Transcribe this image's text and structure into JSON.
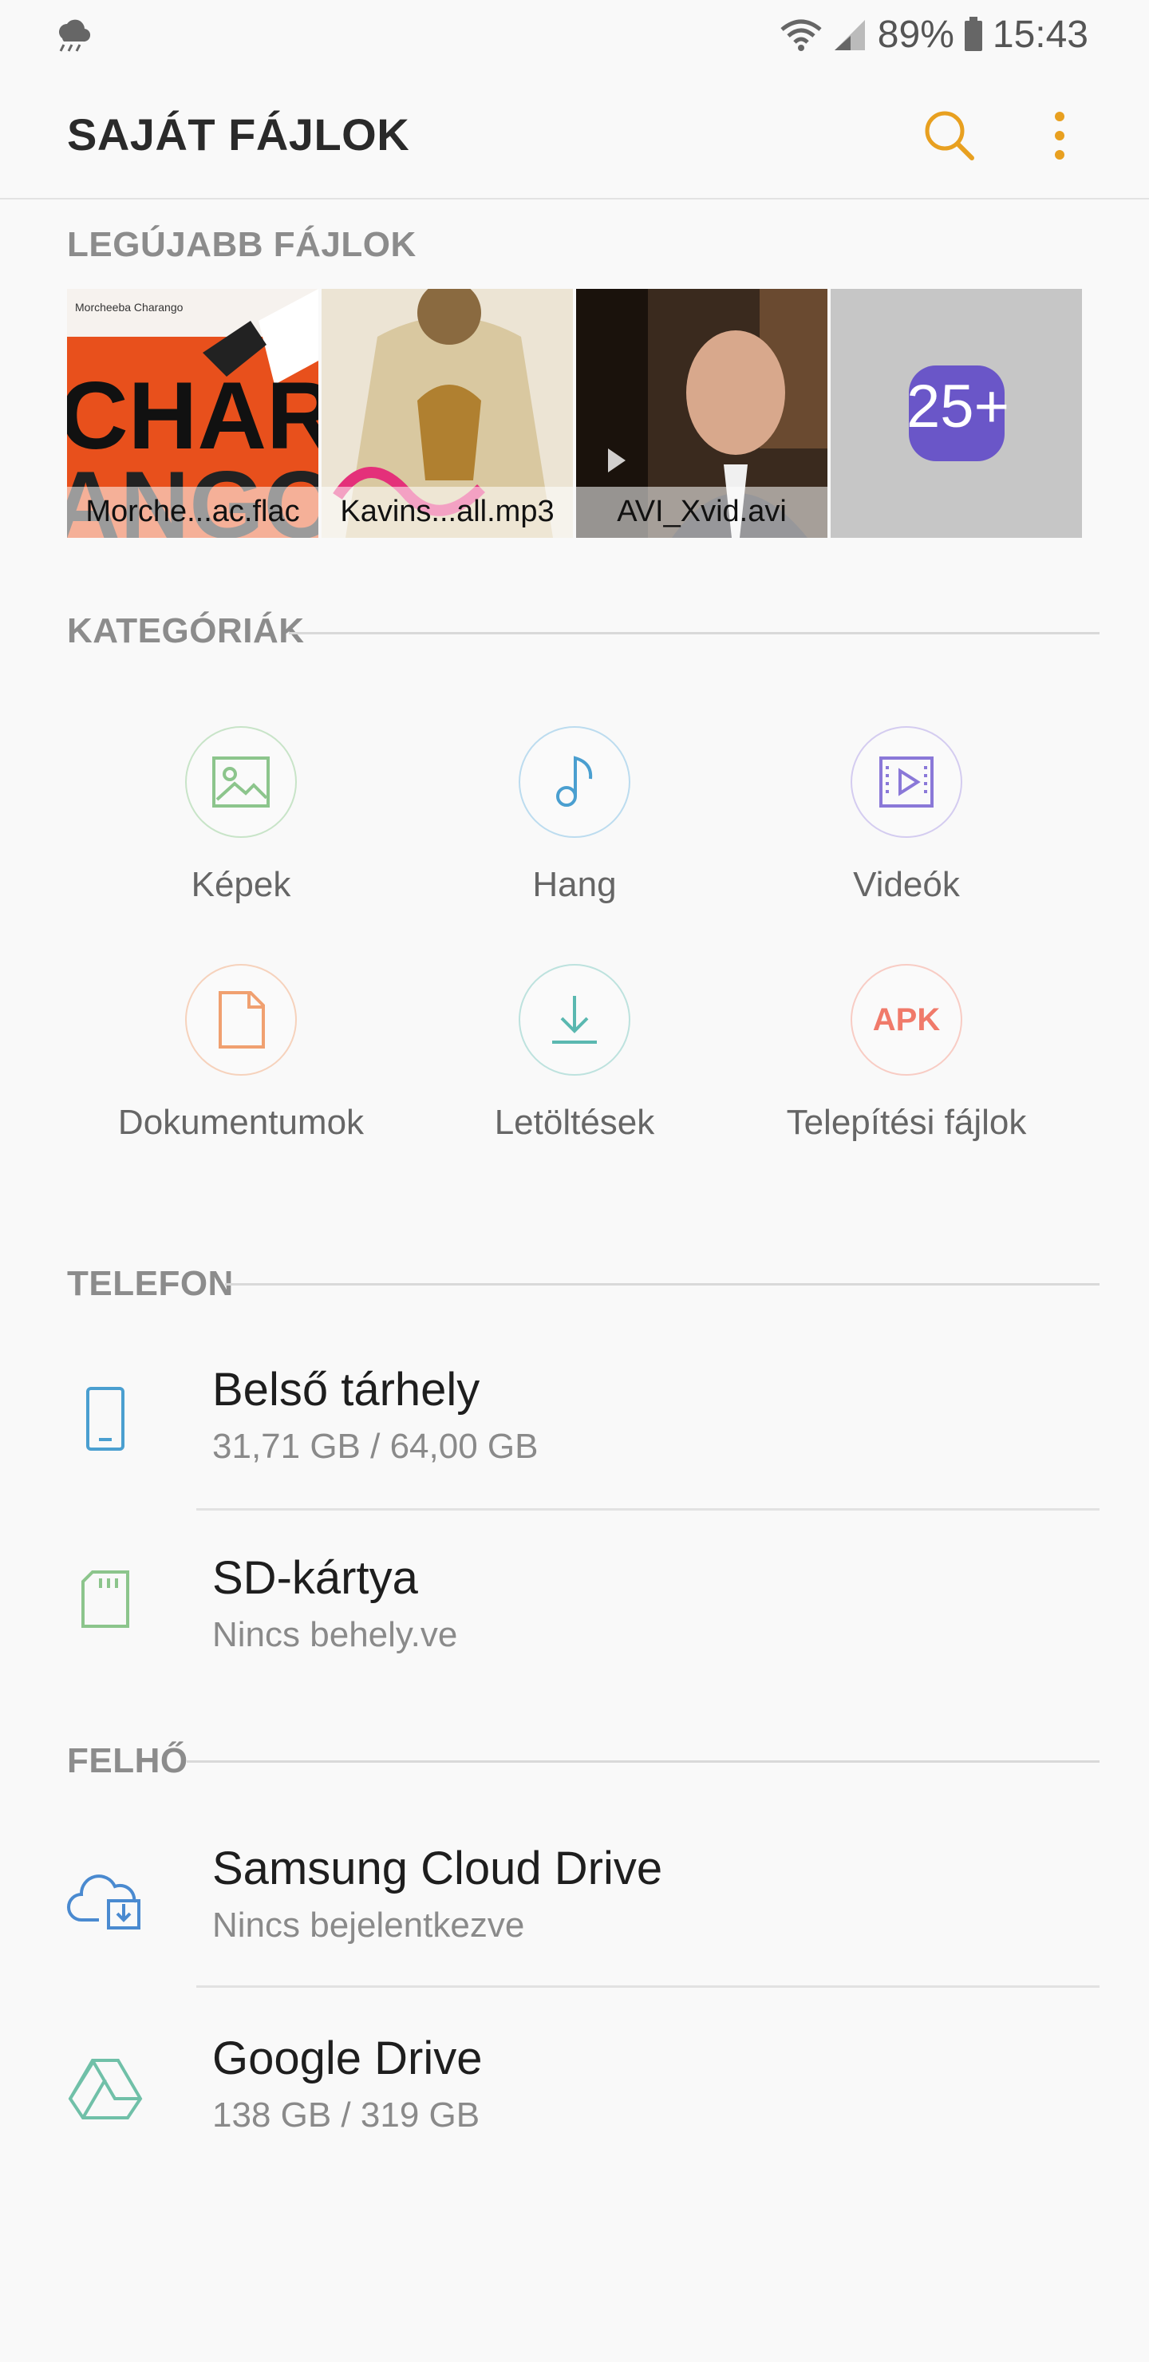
{
  "status_bar": {
    "battery": "89%",
    "time": "15:43",
    "notification_icon": "weather-cloud-icon"
  },
  "app_bar": {
    "title": "SAJÁT FÁJLOK",
    "search_icon": "search-icon",
    "more_icon": "more-options-icon",
    "accent": "#e8a020"
  },
  "recent": {
    "label": "LEGÚJABB FÁJLOK",
    "items": [
      {
        "name": "Morche...ac.flac",
        "type": "audio",
        "cover_text": "Morcheeba Charango"
      },
      {
        "name": "Kavins...all.mp3",
        "type": "audio"
      },
      {
        "name": "AVI_Xvid.avi",
        "type": "video"
      }
    ],
    "more": "25+"
  },
  "categories": {
    "label": "KATEGÓRIÁK",
    "items": [
      {
        "label": "Képek",
        "icon": "image-icon",
        "color": "#8cc58c"
      },
      {
        "label": "Hang",
        "icon": "music-note-icon",
        "color": "#4a9fd0"
      },
      {
        "label": "Videók",
        "icon": "video-icon",
        "color": "#8a78d8"
      },
      {
        "label": "Dokumentumok",
        "icon": "document-icon",
        "color": "#f0a070"
      },
      {
        "label": "Letöltések",
        "icon": "download-icon",
        "color": "#5ab8b0"
      },
      {
        "label": "Telepítési fájlok",
        "icon": "apk-icon",
        "icon_text": "APK",
        "color": "#f07a6a"
      }
    ]
  },
  "phone": {
    "label": "TELEFON",
    "items": [
      {
        "title": "Belső tárhely",
        "subtitle": "31,71 GB / 64,00 GB",
        "icon": "phone-storage-icon"
      },
      {
        "title": "SD-kártya",
        "subtitle": "Nincs behely.ve",
        "icon": "sd-card-icon"
      }
    ]
  },
  "cloud": {
    "label": "FELHŐ",
    "items": [
      {
        "title": "Samsung Cloud Drive",
        "subtitle": "Nincs bejelentkezve",
        "icon": "samsung-cloud-icon"
      },
      {
        "title": "Google Drive",
        "subtitle": "138 GB / 319 GB",
        "icon": "google-drive-icon"
      }
    ]
  }
}
